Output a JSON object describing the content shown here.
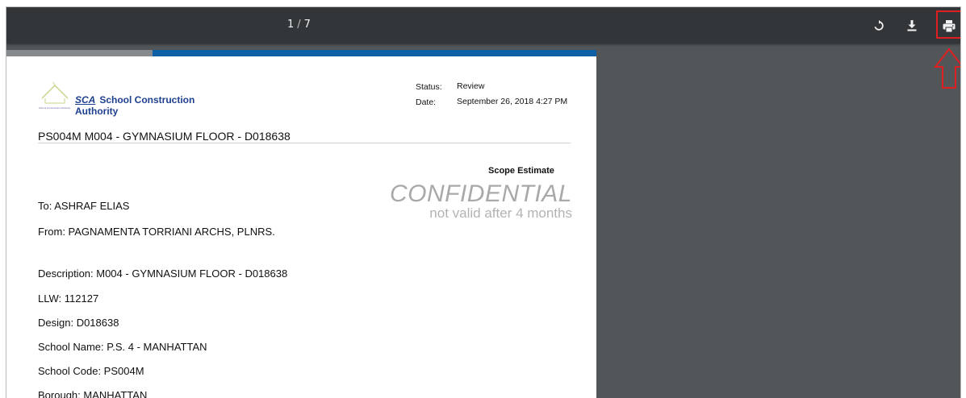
{
  "toolbar": {
    "page_current": "1",
    "page_separator": "/",
    "page_total": "7",
    "rotate_icon": "rotate-icon",
    "download_icon": "download-icon",
    "print_icon": "print-icon",
    "highlight_color": "#e02020",
    "arrow_icon": "up-arrow-icon"
  },
  "document": {
    "logo": {
      "abbr": "SCA",
      "name": "School Construction Authority",
      "tagline": "School Construction Authority"
    },
    "status_label": "Status:",
    "status_value": "Review",
    "date_label": "Date:",
    "date_value": "September 26, 2018  4:27 PM",
    "title": "PS004M M004 - GYMNASIUM FLOOR - D018638",
    "scope_label": "Scope Estimate",
    "watermark": "CONFIDENTIAL",
    "watermark_sub": "not valid after 4 months",
    "to": "To: ASHRAF ELIAS",
    "from": "From: PAGNAMENTA TORRIANI ARCHS, PLNRS.",
    "description": "Description: M004 - GYMNASIUM FLOOR - D018638",
    "llw": "LLW: 112127",
    "design": "Design: D018638",
    "school_name": "School Name: P.S. 4 - MANHATTAN",
    "school_code": "School Code: PS004M",
    "borough": "Borough: MANHATTAN"
  }
}
